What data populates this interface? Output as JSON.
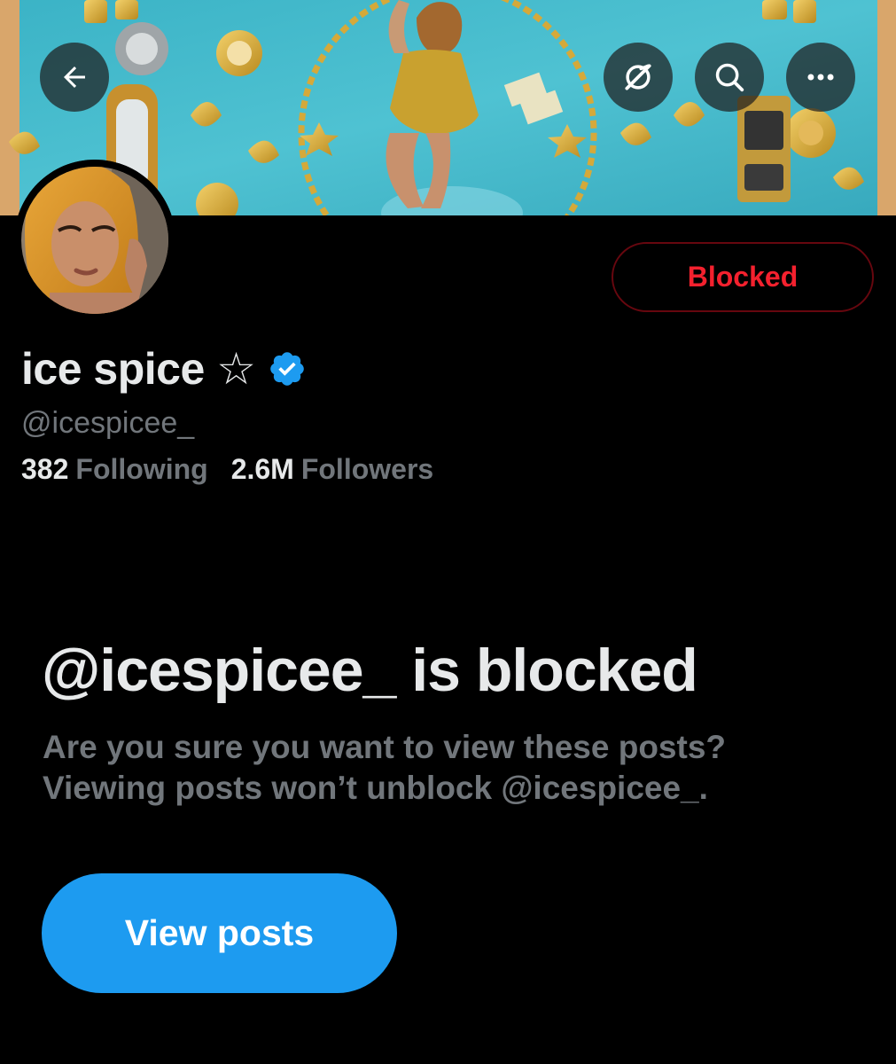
{
  "header": {
    "back_icon": "arrow-left-icon",
    "grok_icon": "grok-icon",
    "search_icon": "search-icon",
    "more_icon": "more-horizontal-icon",
    "banner_alt": "profile-banner-image"
  },
  "profile": {
    "display_name": "ice spice ☆",
    "verified_icon": "verified-badge-icon",
    "handle": "@icespicee_",
    "stats": [
      {
        "value": "382",
        "label": "Following"
      },
      {
        "value": "2.6M",
        "label": "Followers"
      }
    ],
    "blocked_button_label": "Blocked"
  },
  "blocked_notice": {
    "title": "@icespicee_ is blocked",
    "line1": "Are you sure you want to view these posts?",
    "line2": "Viewing posts won’t unblock @icespicee_.",
    "view_posts_label": "View posts"
  },
  "colors": {
    "background": "#000000",
    "primary_text": "#e7e9ea",
    "secondary_text": "#71767b",
    "accent_blue": "#1d9bf0",
    "blocked_red": "#f4212e"
  }
}
